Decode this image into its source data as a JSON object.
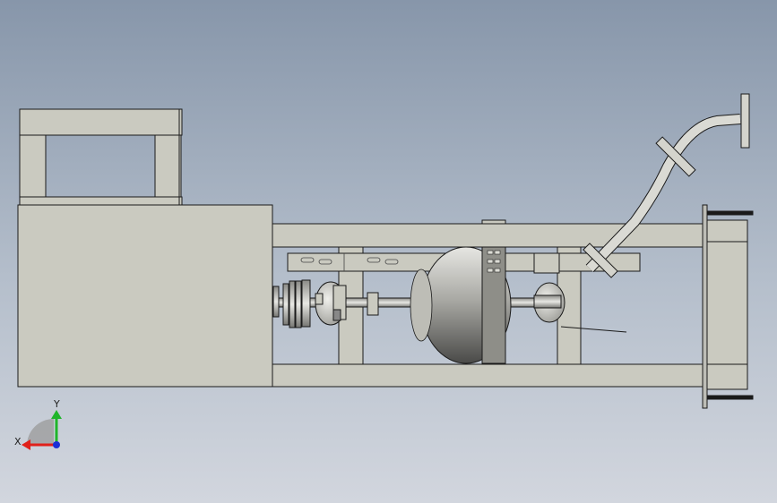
{
  "viewport": {
    "background_top": "#8796aa",
    "background_bottom": "#d2d6de",
    "part_fill": "#cacac0",
    "part_stroke": "#1a1a1a"
  },
  "triad": {
    "x_label": "X",
    "y_label": "Y",
    "x_color": "#e0201a",
    "y_color": "#1fb52a",
    "z_color": "#1a2fd6"
  }
}
